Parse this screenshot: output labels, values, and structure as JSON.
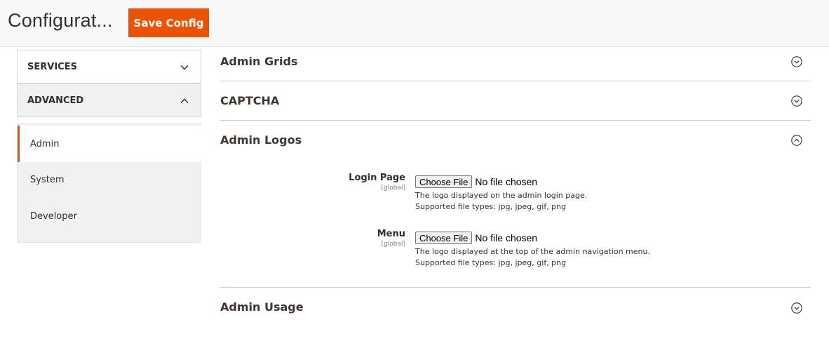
{
  "header": {
    "title": "Configurat...",
    "save_label": "Save Config",
    "accent_color": "#eb5202"
  },
  "sidebar": {
    "sections": [
      {
        "label": "SERVICES",
        "icon": "chevron-down-icon"
      },
      {
        "label": "ADVANCED",
        "icon": "chevron-up-icon"
      }
    ],
    "items": [
      {
        "label": "Admin",
        "active": true
      },
      {
        "label": "System",
        "active": false
      },
      {
        "label": "Developer",
        "active": false
      }
    ]
  },
  "main": {
    "sections": [
      {
        "title": "Admin Grids",
        "icon": "circle-chevron-down-icon"
      },
      {
        "title": "CAPTCHA",
        "icon": "circle-chevron-down-icon"
      },
      {
        "title": "Admin Logos",
        "icon": "circle-chevron-up-icon"
      },
      {
        "title": "Admin Usage",
        "icon": "circle-chevron-down-icon"
      }
    ],
    "fields": [
      {
        "label": "Login Page",
        "scope": "[global]",
        "button": "Choose File",
        "status": "No file chosen",
        "note_1": "The logo displayed on the admin login page.",
        "note_2": "Supported file types: jpg, jpeg, gif, png"
      },
      {
        "label": "Menu",
        "scope": "[global]",
        "button": "Choose File",
        "status": "No file chosen",
        "note_1": "The logo displayed at the top of the admin navigation menu.",
        "note_2": "Supported file types: jpg, jpeg, gif, png"
      }
    ]
  }
}
